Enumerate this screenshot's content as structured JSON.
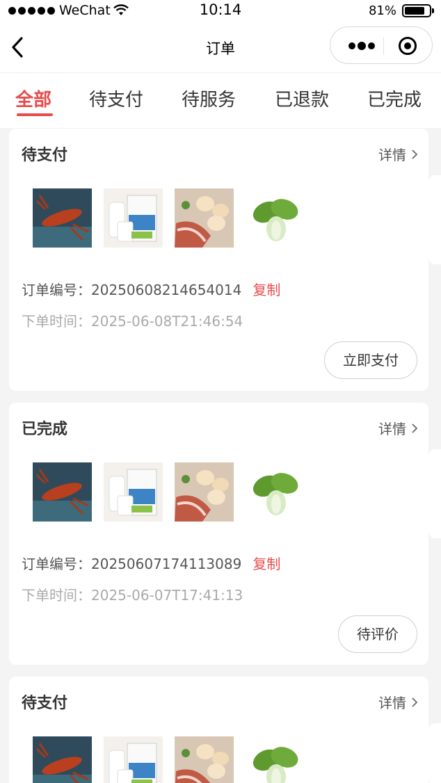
{
  "status_bar": {
    "carrier": "WeChat",
    "time": "10:14",
    "battery_percent": "81%",
    "battery_level": 0.81
  },
  "nav": {
    "title": "订单"
  },
  "tabs": [
    {
      "label": "全部",
      "active": true
    },
    {
      "label": "待支付",
      "active": false
    },
    {
      "label": "待服务",
      "active": false
    },
    {
      "label": "已退款",
      "active": false
    },
    {
      "label": "已完成",
      "active": false
    }
  ],
  "orders": [
    {
      "status": "待支付",
      "detail_label": "详情",
      "order_no_label": "订单编号：",
      "order_no": "20250608214654014",
      "copy_label": "复制",
      "time_label": "下单时间：",
      "order_time": "2025-06-08T21:46:54",
      "action_label": "立即支付",
      "items": [
        "crayfish-image",
        "milk-image",
        "eggs-bacon-image",
        "bok-choy-image"
      ]
    },
    {
      "status": "已完成",
      "detail_label": "详情",
      "order_no_label": "订单编号：",
      "order_no": "20250607174113089",
      "copy_label": "复制",
      "time_label": "下单时间：",
      "order_time": "2025-06-07T17:41:13",
      "action_label": "待评价",
      "items": [
        "crayfish-image",
        "milk-image",
        "eggs-bacon-image",
        "bok-choy-image"
      ]
    },
    {
      "status": "待支付",
      "detail_label": "详情",
      "items": [
        "crayfish-image",
        "milk-image",
        "eggs-bacon-image",
        "bok-choy-image"
      ]
    }
  ],
  "colors": {
    "accent": "#e84b4b",
    "page_bg": "#f4f4f4",
    "card_bg": "#ffffff"
  }
}
